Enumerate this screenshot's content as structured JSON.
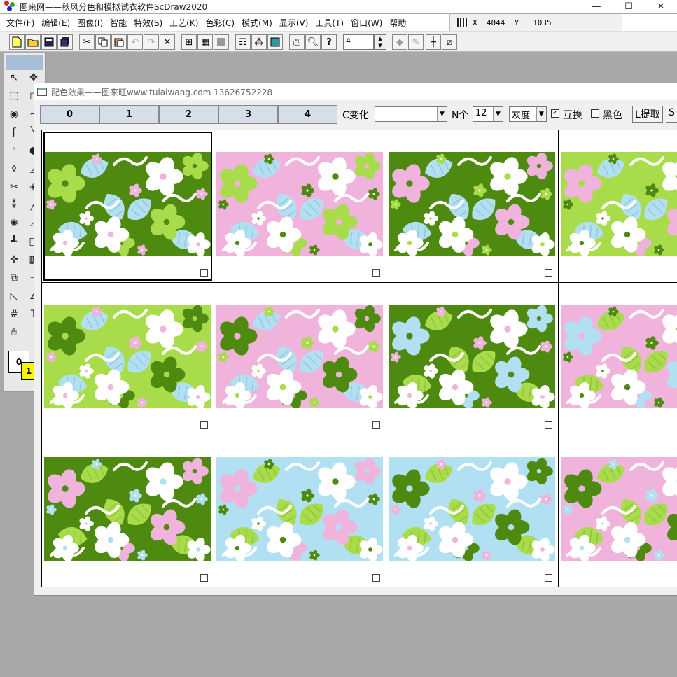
{
  "app": {
    "title": "图来网——秋风分色和模拟试衣软件ScDraw2020",
    "controls": {
      "minimize": "—",
      "maximize": "☐",
      "close": "✕"
    }
  },
  "menu": [
    "文件(F)",
    "编辑(E)",
    "图像(I)",
    "智能",
    "特效(S)",
    "工艺(K)",
    "色彩(C)",
    "模式(M)",
    "显示(V)",
    "工具(T)",
    "窗口(W)",
    "帮助"
  ],
  "coords": {
    "text": "X  4044  Y   1035"
  },
  "toolbar": {
    "spin_value": "4"
  },
  "child_window": {
    "title": "配色效果——图来旺www.tulaiwang.com  13626752228",
    "segments": [
      "0",
      "1",
      "2",
      "3",
      "4"
    ],
    "c_change_label": "C变化",
    "c_change_value": "",
    "n_label": "N个",
    "n_value": "12",
    "gray_value": "灰度",
    "swap_label": "互换",
    "swap_checked": "✓",
    "black_label": "黑色",
    "black_checked": "",
    "extract_button": "L提取",
    "s_button": "S"
  },
  "tool_panel": {
    "fg_label": "0",
    "bg_label": "1"
  },
  "palette": {
    "dark_green": "#4f8a10",
    "lime": "#a8dc4a",
    "pink": "#f0b4dc",
    "blue": "#b0e0f2",
    "white": "#ffffff"
  },
  "swatches": [
    {
      "bg": "dark_green",
      "big": "lime",
      "leaf": "blue",
      "flower": "white",
      "small": "pink"
    },
    {
      "bg": "pink",
      "big": "lime",
      "leaf": "blue",
      "flower": "white",
      "small": "dark_green"
    },
    {
      "bg": "dark_green",
      "big": "pink",
      "leaf": "blue",
      "flower": "white",
      "small": "lime"
    },
    {
      "bg": "lime",
      "big": "pink",
      "leaf": "blue",
      "flower": "white",
      "small": "dark_green"
    },
    {
      "bg": "lime",
      "big": "dark_green",
      "leaf": "blue",
      "flower": "white",
      "small": "pink"
    },
    {
      "bg": "pink",
      "big": "dark_green",
      "leaf": "blue",
      "flower": "white",
      "small": "lime"
    },
    {
      "bg": "dark_green",
      "big": "blue",
      "leaf": "lime",
      "flower": "white",
      "small": "pink"
    },
    {
      "bg": "pink",
      "big": "blue",
      "leaf": "lime",
      "flower": "white",
      "small": "dark_green"
    },
    {
      "bg": "dark_green",
      "big": "pink",
      "leaf": "lime",
      "flower": "white",
      "small": "blue"
    },
    {
      "bg": "blue",
      "big": "pink",
      "leaf": "lime",
      "flower": "white",
      "small": "dark_green"
    },
    {
      "bg": "blue",
      "big": "dark_green",
      "leaf": "lime",
      "flower": "white",
      "small": "pink"
    },
    {
      "bg": "pink",
      "big": "dark_green",
      "leaf": "lime",
      "flower": "white",
      "small": "blue"
    }
  ]
}
